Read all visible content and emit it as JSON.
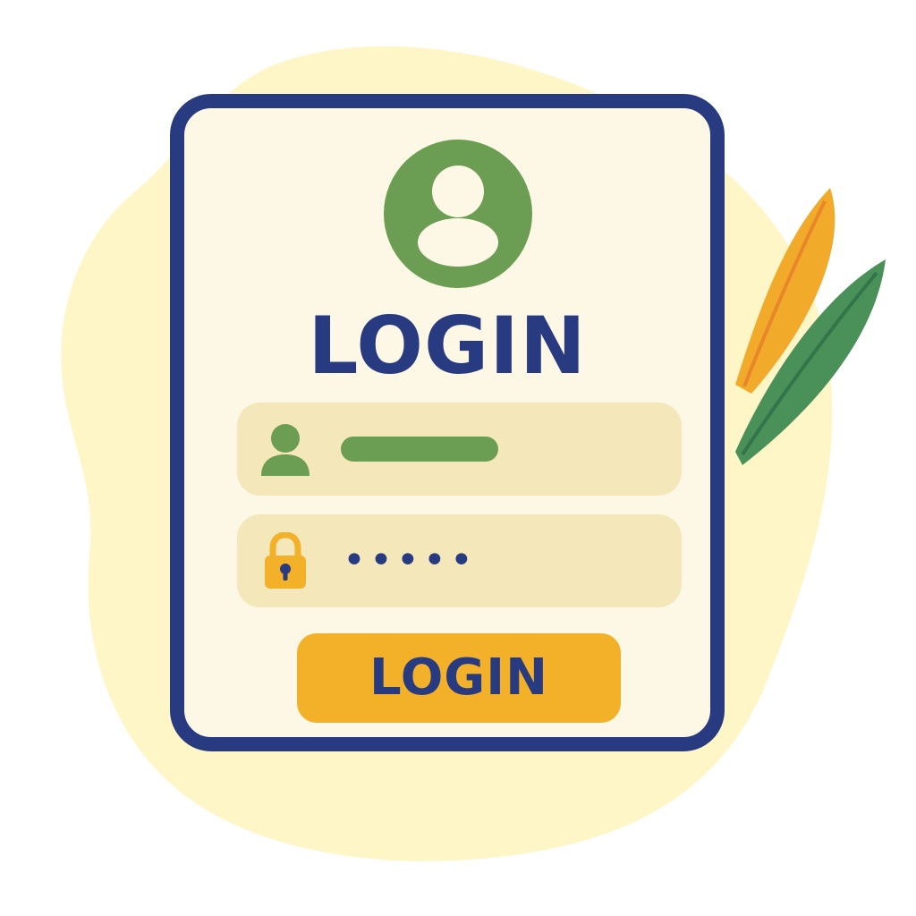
{
  "login_form": {
    "title": "LOGIN",
    "avatar_icon": "user-avatar-icon",
    "username_field": {
      "icon": "user-icon",
      "value_shown_as": "filled-placeholder-bar"
    },
    "password_field": {
      "icon": "padlock-icon",
      "value": "•••••"
    },
    "submit_label": "LOGIN"
  },
  "colors": {
    "navy": "#293b80",
    "green": "#6b9e52",
    "amber": "#f2b129",
    "card_background": "#fdf8e6",
    "field_background": "#f4e7b9",
    "backdrop_blob": "#fef6c6",
    "leaf_orange": "#f1aa2a",
    "leaf_green": "#4a9159"
  }
}
